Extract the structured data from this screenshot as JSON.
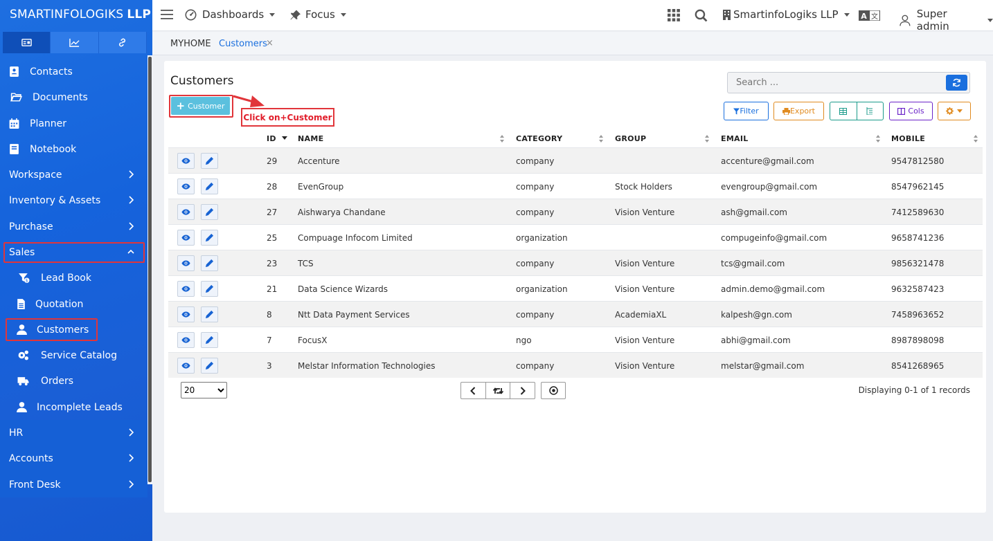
{
  "brand": {
    "name": "SMARTINFOLOGIKS",
    "suffix": "LLP"
  },
  "sidebar": {
    "tabs": [
      {
        "icon": "id-card-icon"
      },
      {
        "icon": "chart-line-icon"
      },
      {
        "icon": "link-icon"
      }
    ],
    "items": [
      {
        "label": "Contacts"
      },
      {
        "label": "Documents"
      },
      {
        "label": "Planner"
      },
      {
        "label": "Notebook"
      },
      {
        "label": "Workspace"
      },
      {
        "label": "Inventory & Assets"
      },
      {
        "label": "Purchase"
      },
      {
        "label": "Sales"
      },
      {
        "label": "Lead Book"
      },
      {
        "label": "Quotation"
      },
      {
        "label": "Customers"
      },
      {
        "label": "Service Catalog"
      },
      {
        "label": "Orders"
      },
      {
        "label": "Incomplete Leads"
      },
      {
        "label": "HR"
      },
      {
        "label": "Accounts"
      },
      {
        "label": "Front Desk"
      }
    ]
  },
  "topbar": {
    "dashboards": "Dashboards",
    "focus": "Focus",
    "company": "SmartinfoLogiks LLP",
    "user": "Super admin"
  },
  "breadcrumb": {
    "home": "MYHOME",
    "current": "Customers",
    "close": "×"
  },
  "main": {
    "title": "Customers",
    "add_button": "Customer",
    "search_placeholder": "Search ...",
    "filter": "Filter",
    "export": "Export",
    "cols": "Cols",
    "callout": "Click on+Customer"
  },
  "table": {
    "columns": [
      "ID",
      "NAME",
      "CATEGORY",
      "GROUP",
      "EMAIL",
      "MOBILE"
    ],
    "rows": [
      {
        "id": "29",
        "name": "Accenture",
        "category": "company",
        "group": "",
        "email": "accenture@gmail.com",
        "mobile": "9547812580"
      },
      {
        "id": "28",
        "name": "EvenGroup",
        "category": "company",
        "group": "Stock Holders",
        "email": "evengroup@gmail.com",
        "mobile": "8547962145"
      },
      {
        "id": "27",
        "name": "Aishwarya Chandane",
        "category": "company",
        "group": "Vision Venture",
        "email": "ash@gmail.com",
        "mobile": "7412589630"
      },
      {
        "id": "25",
        "name": "Compuage Infocom Limited",
        "category": "organization",
        "group": "",
        "email": "compugeinfo@gmail.com",
        "mobile": "9658741236"
      },
      {
        "id": "23",
        "name": "TCS",
        "category": "company",
        "group": "Vision Venture",
        "email": "tcs@gmail.com",
        "mobile": "9856321478"
      },
      {
        "id": "21",
        "name": "Data Science Wizards",
        "category": "organization",
        "group": "Vision Venture",
        "email": "admin.demo@gmail.com",
        "mobile": "9632587423"
      },
      {
        "id": "8",
        "name": "Ntt Data Payment Services",
        "category": "company",
        "group": "AcademiaXL",
        "email": "kalpesh@gn.com",
        "mobile": "7458963652"
      },
      {
        "id": "7",
        "name": "FocusX",
        "category": "ngo",
        "group": "Vision Venture",
        "email": "abhi@gmail.com",
        "mobile": "8987898098"
      },
      {
        "id": "3",
        "name": "Melstar Information Technologies",
        "category": "company",
        "group": "Vision Venture",
        "email": "melstar@gmail.com",
        "mobile": "8541268965"
      }
    ]
  },
  "pagination": {
    "page_size": "20",
    "records": "Displaying 0-1 of 1 records"
  },
  "colors": {
    "sidebar": "#1563dc",
    "accent": "#1a6fde",
    "highlight": "#e1353a",
    "filter": "#1a6fde",
    "export": "#e08a1e",
    "view": "#1a9a8a",
    "cols": "#6a22c8",
    "settings": "#e08a1e"
  }
}
